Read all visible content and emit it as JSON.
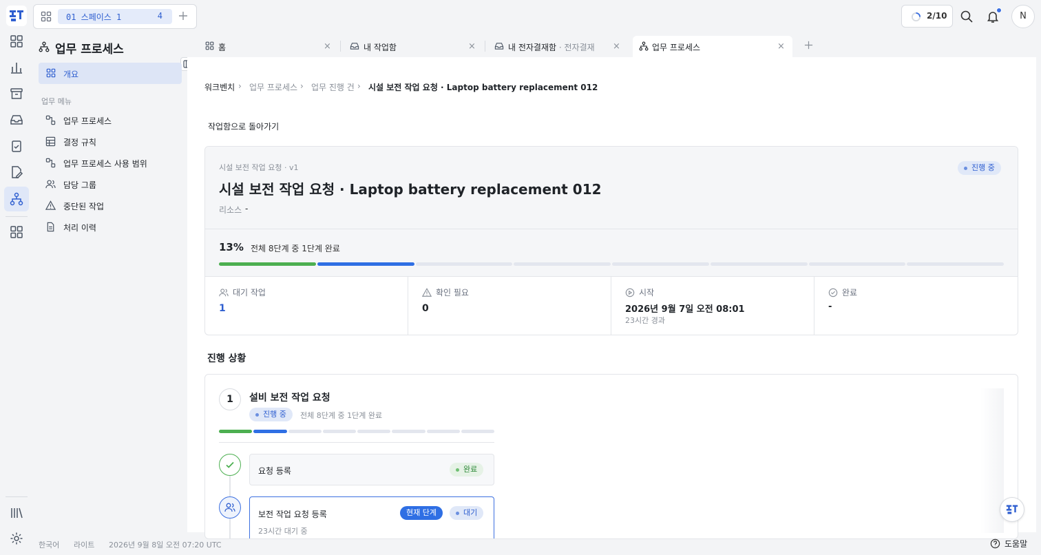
{
  "topbar": {
    "space_name": "01 스페이스 1",
    "space_count": "4",
    "task_progress": "2/10",
    "avatar_initial": "N"
  },
  "sidebar": {
    "title": "업무 프로세스",
    "overview": "개요",
    "section_label": "업무 메뉴",
    "items": [
      {
        "label": "업무 프로세스",
        "icon": "process-icon"
      },
      {
        "label": "결정 규칙",
        "icon": "table-icon"
      },
      {
        "label": "업무 프로세스 사용 범위",
        "icon": "process-icon"
      },
      {
        "label": "담당 그룹",
        "icon": "users-icon"
      },
      {
        "label": "중단된 작업",
        "icon": "warning-icon"
      },
      {
        "label": "처리 이력",
        "icon": "document-icon"
      }
    ]
  },
  "tabs": [
    {
      "label": "홈",
      "sub": ""
    },
    {
      "label": "내 작업함",
      "sub": ""
    },
    {
      "label": "내 전자결재함",
      "sub": " · 전자결재"
    },
    {
      "label": "업무 프로세스",
      "sub": ""
    }
  ],
  "breadcrumb": [
    "워크벤치",
    "업무 프로세스",
    "업무 진행 건",
    "시설 보전 작업 요청 · Laptop battery replacement 012"
  ],
  "back_link": "작업함으로 돌아가기",
  "instance": {
    "subtitle": "시설 보전 작업 요청 · v1",
    "title": "시설 보전 작업 요청 · Laptop battery replacement 012",
    "status": "진행 중",
    "resource_label": "리소스",
    "resource_value": "-",
    "percent": "13%",
    "progress_text": "전체 8단계 중 1단계 완료",
    "steps_total": 8,
    "steps_done": 1,
    "steps_current": 1
  },
  "stats": [
    {
      "label": "대기 작업",
      "value": "1",
      "sub": "",
      "icon": "users-icon"
    },
    {
      "label": "확인 필요",
      "value": "0",
      "sub": "",
      "icon": "warning-icon"
    },
    {
      "label": "시작",
      "value": "2026년 9월 7일 오전 08:01",
      "sub": "23시간 경과",
      "icon": "play-circle-icon"
    },
    {
      "label": "완료",
      "value": "-",
      "sub": "",
      "icon": "check-circle-icon"
    }
  ],
  "progress_section": {
    "title": "진행 상황",
    "stage_number": "1",
    "stage_title": "설비 보전 작업 요청",
    "stage_status": "진행 중",
    "stage_progress_text": "전체 8단계 중 1단계 완료",
    "steps": [
      {
        "title": "요청 등록",
        "status": "완료"
      },
      {
        "title": "보전 작업 요청 등록",
        "current_label": "현재 단계",
        "status": "대기",
        "sub": "23시간 대기 중"
      }
    ]
  },
  "footer": {
    "language": "한국어",
    "theme": "라이트",
    "timestamp": "2026년 9월 8일 오전 07:20 UTC",
    "help": "도움말"
  },
  "colors": {
    "accent": "#2f6fe4",
    "done": "#4caf50",
    "badge_bg": "#e0e8f8"
  }
}
